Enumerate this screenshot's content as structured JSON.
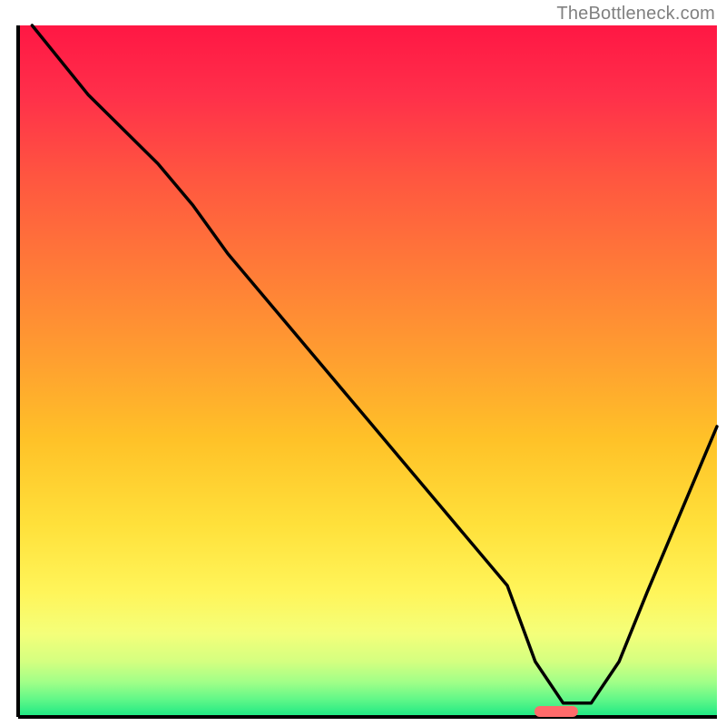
{
  "watermark": "TheBottleneck.com",
  "chart_data": {
    "type": "line",
    "title": "",
    "xlabel": "",
    "ylabel": "",
    "xlim": [
      0,
      100
    ],
    "ylim": [
      0,
      100
    ],
    "legend": null,
    "grid": false,
    "background": "rainbow-gradient-red-to-green",
    "minimum_marker": {
      "x": 77,
      "color": "#ff6b6b"
    },
    "series": [
      {
        "name": "bottleneck-curve",
        "x": [
          2,
          10,
          20,
          25,
          30,
          40,
          50,
          60,
          70,
          74,
          78,
          82,
          86,
          90,
          95,
          100
        ],
        "y": [
          100,
          90,
          80,
          74,
          67,
          55,
          43,
          31,
          19,
          8,
          2,
          2,
          8,
          18,
          30,
          42
        ],
        "color": "#000000"
      }
    ]
  }
}
